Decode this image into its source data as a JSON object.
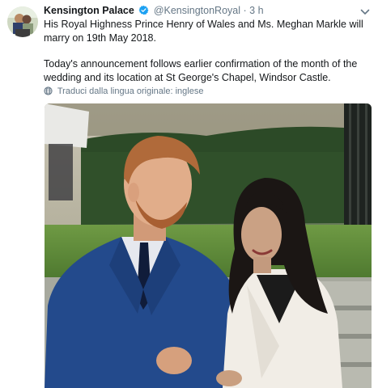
{
  "tweet": {
    "display_name": "Kensington Palace",
    "handle": "@KensingtonRoyal",
    "separator": "·",
    "time": "3 h",
    "verified_icon": "verified-badge-icon",
    "more_icon": "chevron-down-icon",
    "paragraphs": [
      "His Royal Highness Prince Henry of Wales and Ms. Meghan Markle will marry on 19th May 2018.",
      "Today's announcement follows earlier confirmation of the month of the wedding and its location at St George's Chapel, Windsor Castle."
    ],
    "translate_label": "Traduci dalla lingua originale: inglese",
    "translate_icon": "globe-icon"
  },
  "colors": {
    "text": "#14171a",
    "secondary": "#657786",
    "verified": "#1da1f2"
  }
}
